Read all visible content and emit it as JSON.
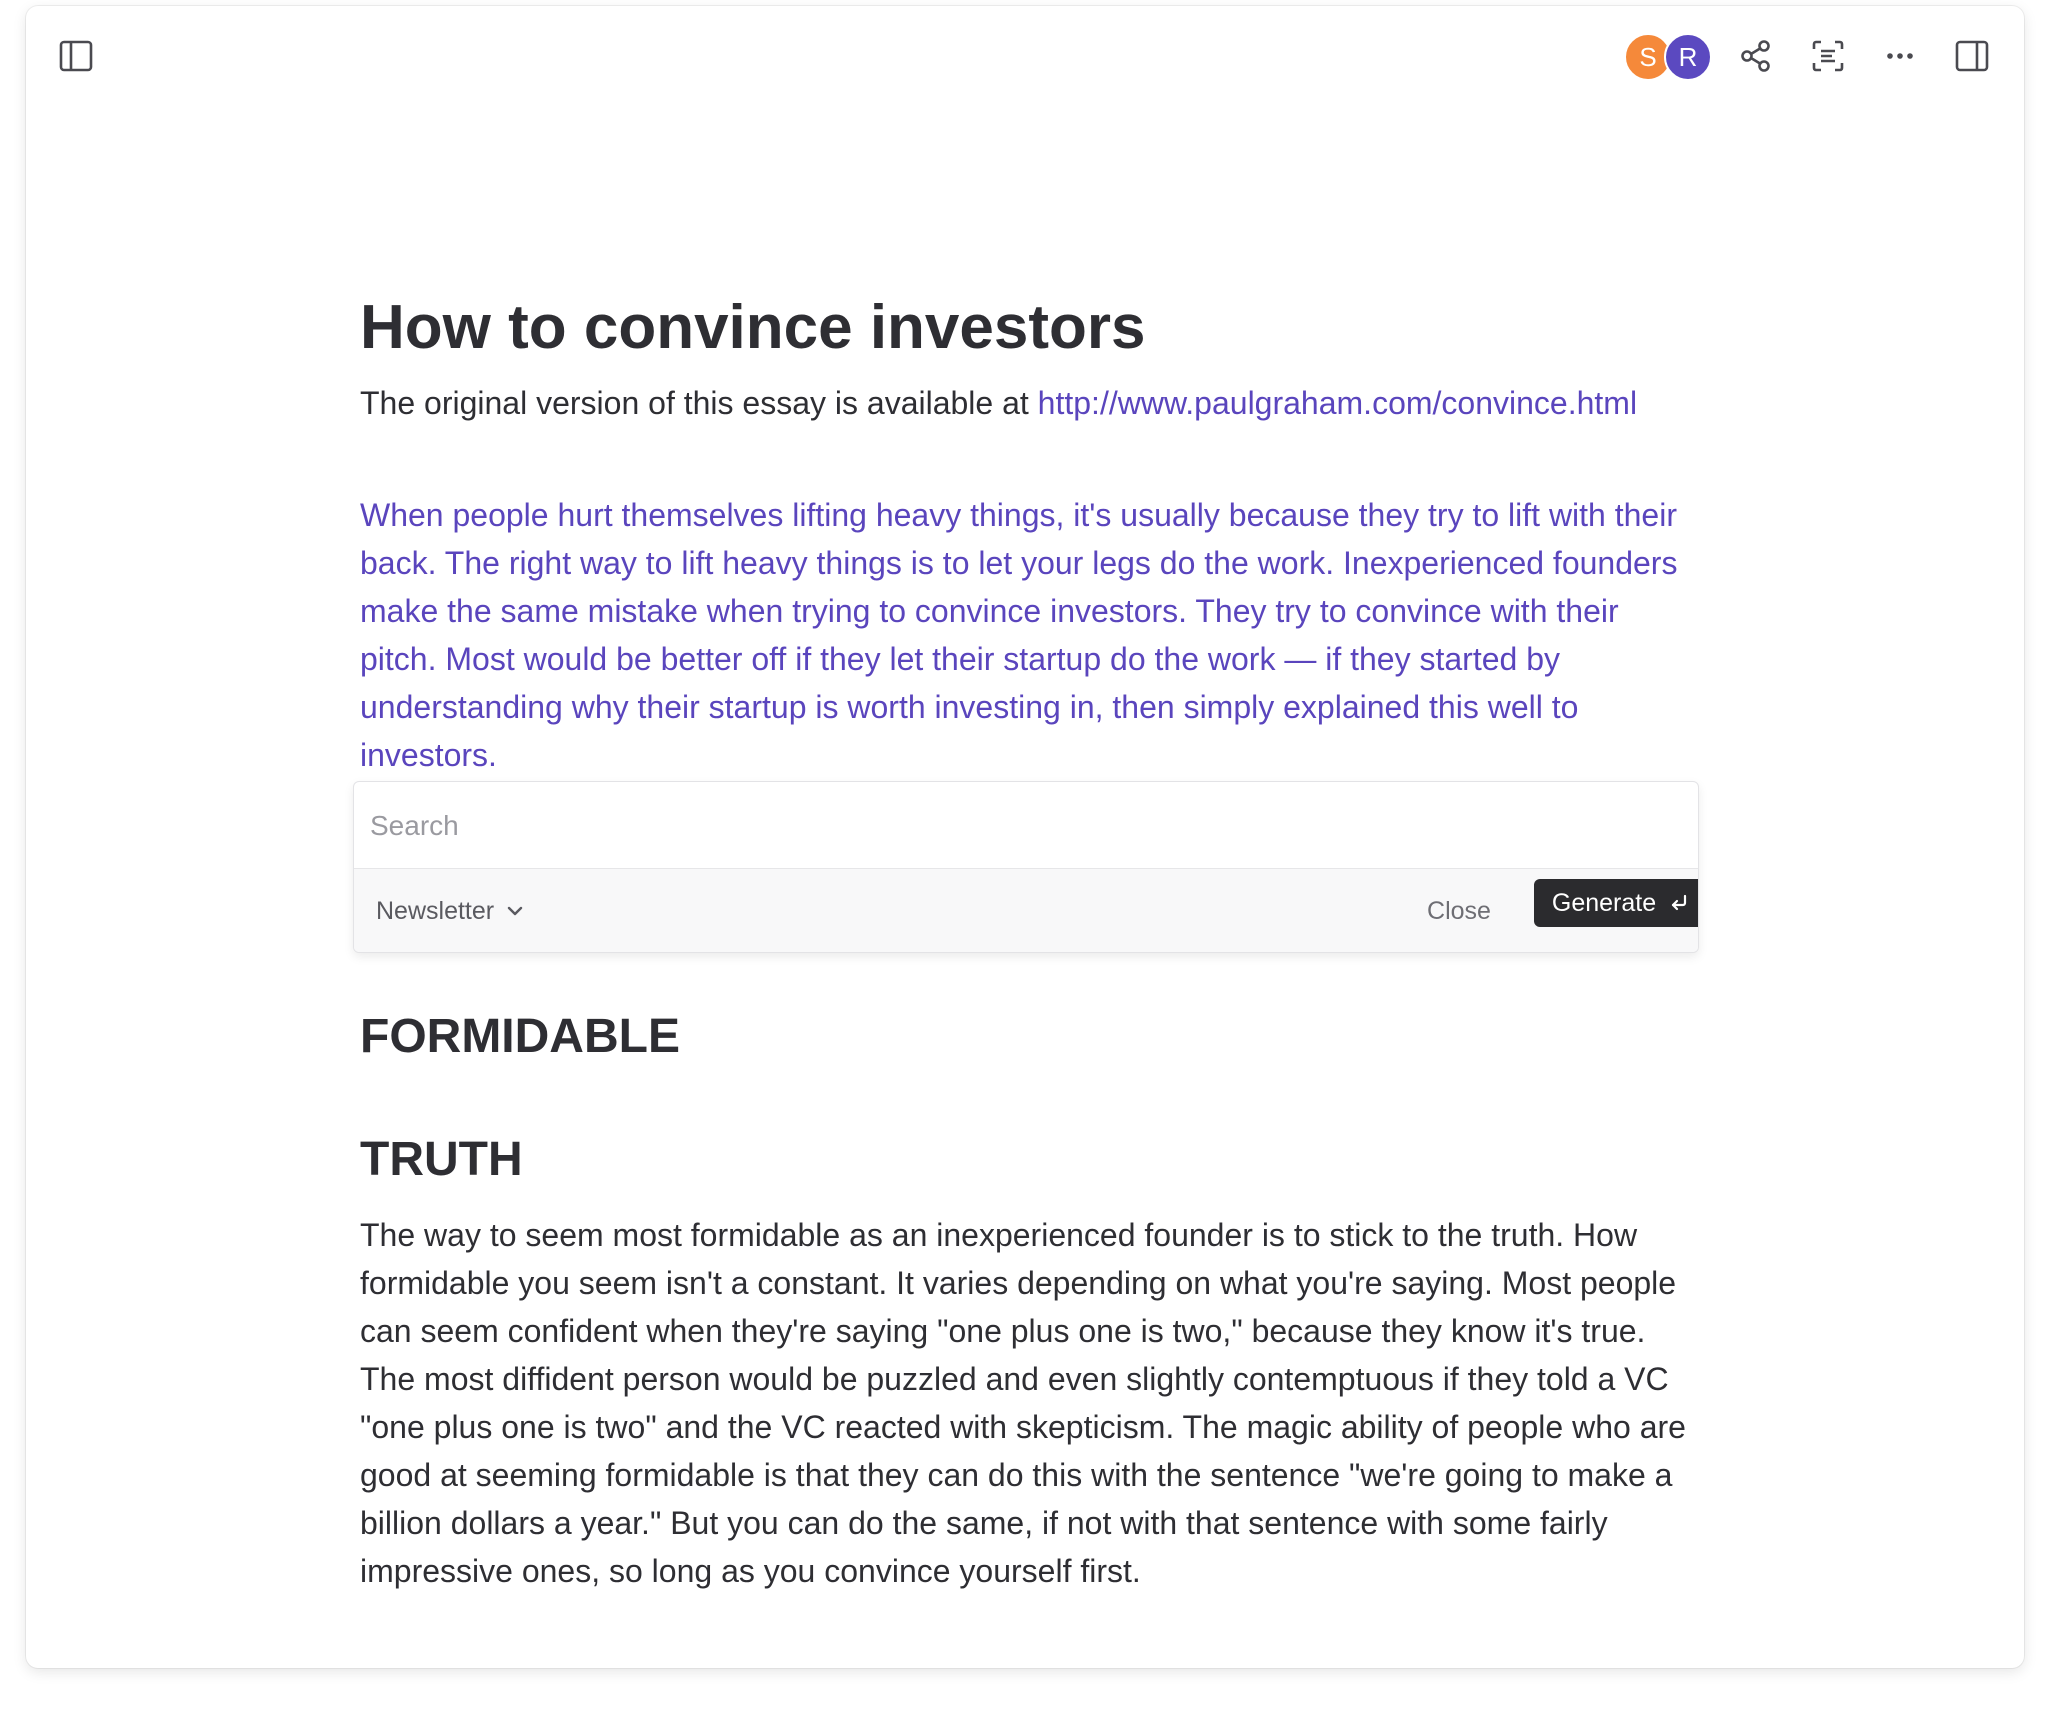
{
  "toolbar": {
    "avatars": [
      {
        "initial": "S",
        "color": "#f5893a"
      },
      {
        "initial": "R",
        "color": "#5b49c0"
      }
    ],
    "icons": [
      "sidebar-left-icon",
      "share-icon",
      "scan-text-icon",
      "more-icon",
      "sidebar-right-icon"
    ]
  },
  "document": {
    "title": "How to convince investors",
    "intro_text": "The original version of this essay is available at ",
    "intro_link": "http://www.paulgraham.com/convince.html",
    "highlighted_paragraph": "When people hurt themselves lifting heavy things, it's usually because they try to lift with their back. The right way to lift heavy things is to let your legs do the work. Inexperienced founders make the same mistake when trying to convince investors. They try to convince with their pitch. Most would be better off if they let their startup do the work — if they started by understanding why their startup is worth investing in, then simply explained this well to investors.",
    "heading_1": "FORMIDABLE",
    "heading_2": "TRUTH",
    "body_paragraph": "The way to seem most formidable as an inexperienced founder is to stick to the truth. How formidable you seem isn't a constant. It varies depending on what you're saying. Most people can seem confident when they're saying \"one plus one is two,\" because they know it's true. The most diffident person would be puzzled and even slightly contemptuous if they told a VC \"one plus one is two\" and the VC reacted with skepticism. The magic ability of people who are good at seeming formidable is that they can do this with the sentence \"we're going to make a billion dollars a year.\" But you can do the same, if not with that sentence with some fairly impressive ones, so long as you convince yourself first."
  },
  "ai_panel": {
    "search_placeholder": "Search",
    "search_value": "",
    "template_selected": "Newsletter",
    "close_label": "Close",
    "generate_label": "Generate"
  },
  "colors": {
    "accent": "#5a45bd",
    "text": "#2e2e33",
    "button_dark": "#2b2b2e"
  }
}
